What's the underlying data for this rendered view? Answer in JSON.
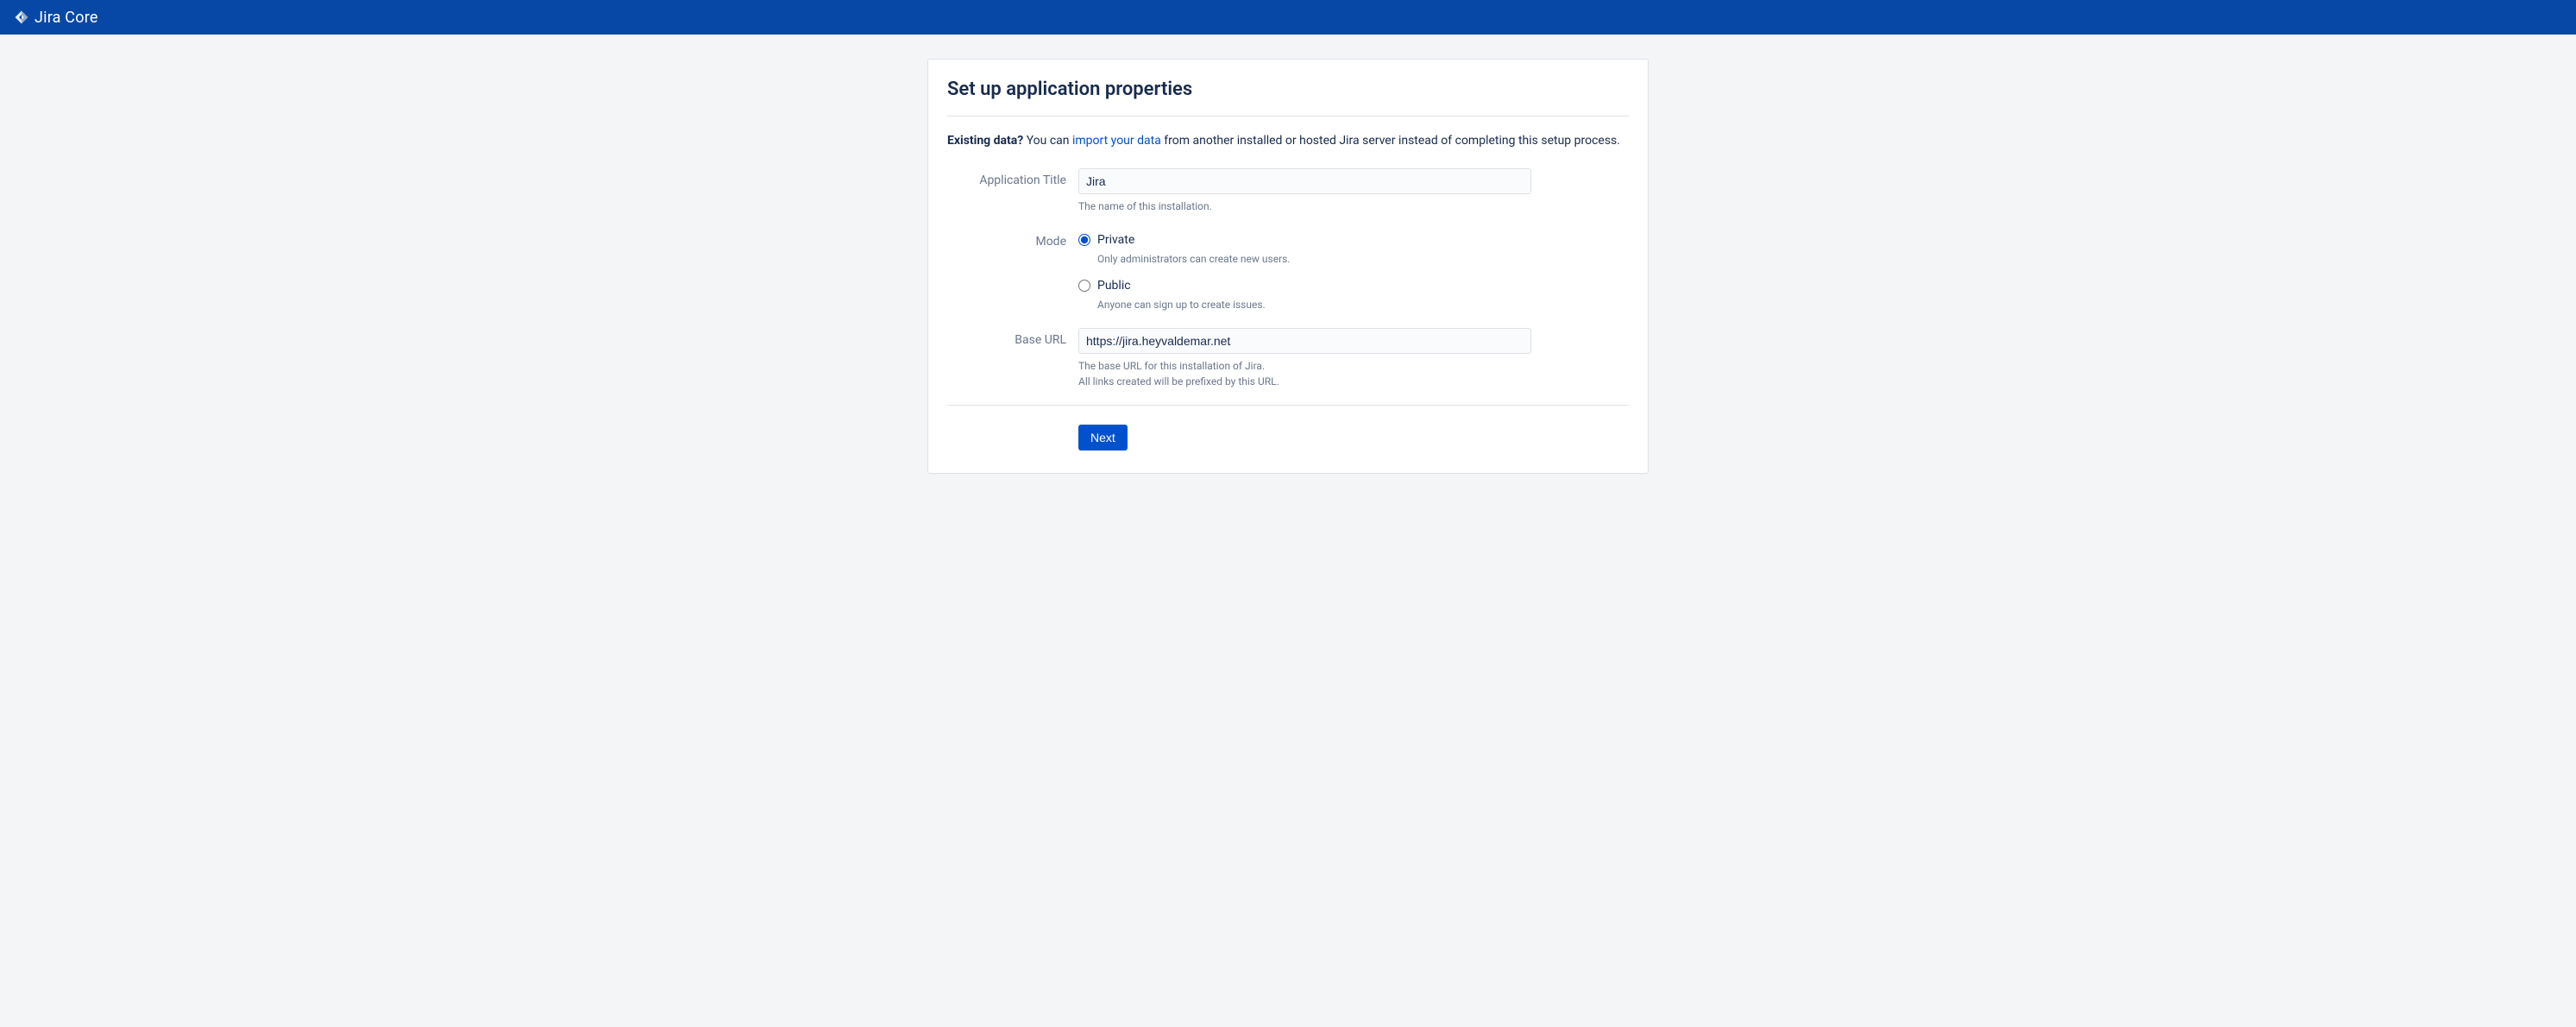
{
  "header": {
    "product_name": "Jira Core"
  },
  "page": {
    "title": "Set up application properties",
    "intro": {
      "bold_prefix": "Existing data?",
      "before_link": " You can ",
      "link_text": "import your data",
      "after_link": " from another installed or hosted Jira server instead of completing this setup process."
    }
  },
  "form": {
    "app_title": {
      "label": "Application Title",
      "value": "Jira",
      "help": "The name of this installation."
    },
    "mode": {
      "label": "Mode",
      "private": {
        "label": "Private",
        "help": "Only administrators can create new users."
      },
      "public": {
        "label": "Public",
        "help": "Anyone can sign up to create issues."
      }
    },
    "base_url": {
      "label": "Base URL",
      "value": "https://jira.heyvaldemar.net",
      "help1": "The base URL for this installation of Jira.",
      "help2": "All links created will be prefixed by this URL."
    },
    "next_button": "Next"
  }
}
